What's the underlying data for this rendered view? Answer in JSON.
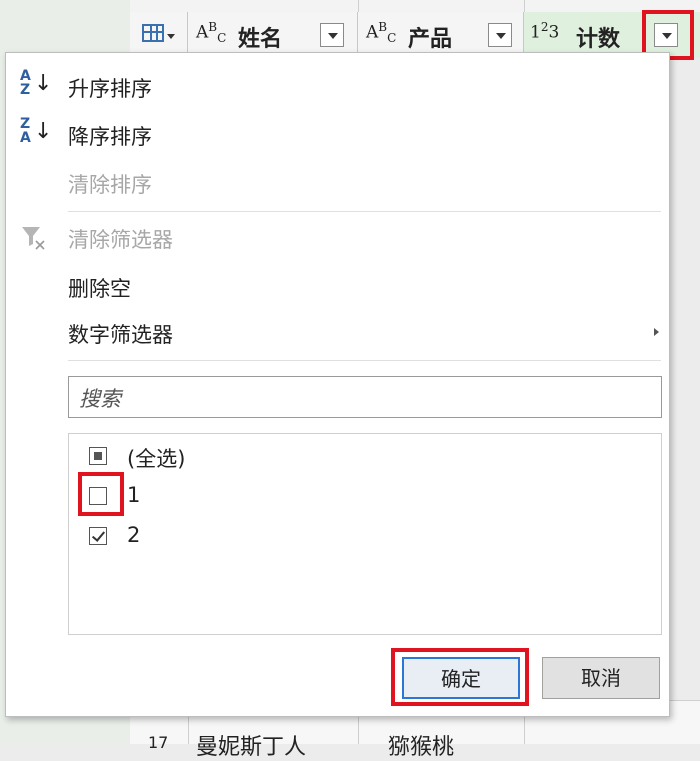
{
  "grid": {
    "columns": [
      {
        "type_label": "ABC",
        "name": "姓名"
      },
      {
        "type_label": "ABC",
        "name": "产品"
      },
      {
        "type_label": "123",
        "name": "计数"
      }
    ],
    "bottom_row": {
      "index": "17",
      "name": "曼妮斯丁人",
      "product": "猕猴桃"
    }
  },
  "menu": {
    "sort_asc": "升序排序",
    "sort_desc": "降序排序",
    "clear_sort": "清除排序",
    "clear_filter": "清除筛选器",
    "remove_empty": "删除空",
    "number_filters": "数字筛选器",
    "search_placeholder": "搜索",
    "list": {
      "select_all": "(全选)",
      "items": [
        "1",
        "2"
      ]
    },
    "ok": "确定",
    "cancel": "取消"
  },
  "icons": {
    "sort_asc_letters": [
      "A",
      "Z"
    ],
    "sort_desc_letters": [
      "Z",
      "A"
    ]
  },
  "colors": {
    "highlight": "#e0141e",
    "accent": "#2c77d6",
    "header_green": "#dff0df"
  }
}
